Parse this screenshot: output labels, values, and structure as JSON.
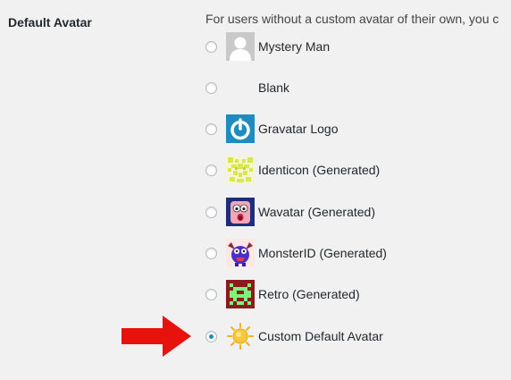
{
  "setting": {
    "label": "Default Avatar",
    "description": "For users without a custom avatar of their own, you c"
  },
  "options": [
    {
      "label": "Mystery Man",
      "selected": false,
      "icon": "mystery-man-icon"
    },
    {
      "label": "Blank",
      "selected": false,
      "icon": "blank-icon"
    },
    {
      "label": "Gravatar Logo",
      "selected": false,
      "icon": "gravatar-logo-icon"
    },
    {
      "label": "Identicon (Generated)",
      "selected": false,
      "icon": "identicon-icon"
    },
    {
      "label": "Wavatar (Generated)",
      "selected": false,
      "icon": "wavatar-icon"
    },
    {
      "label": "MonsterID (Generated)",
      "selected": false,
      "icon": "monsterid-icon"
    },
    {
      "label": "Retro (Generated)",
      "selected": false,
      "icon": "retro-icon"
    },
    {
      "label": "Custom Default Avatar",
      "selected": true,
      "icon": "sun-icon"
    }
  ],
  "colors": {
    "radio_dot": "#1e8cbe",
    "arrow": "#e8120c",
    "gravatar_blue": "#1e8cbe",
    "retro": "#8b1b1b"
  }
}
